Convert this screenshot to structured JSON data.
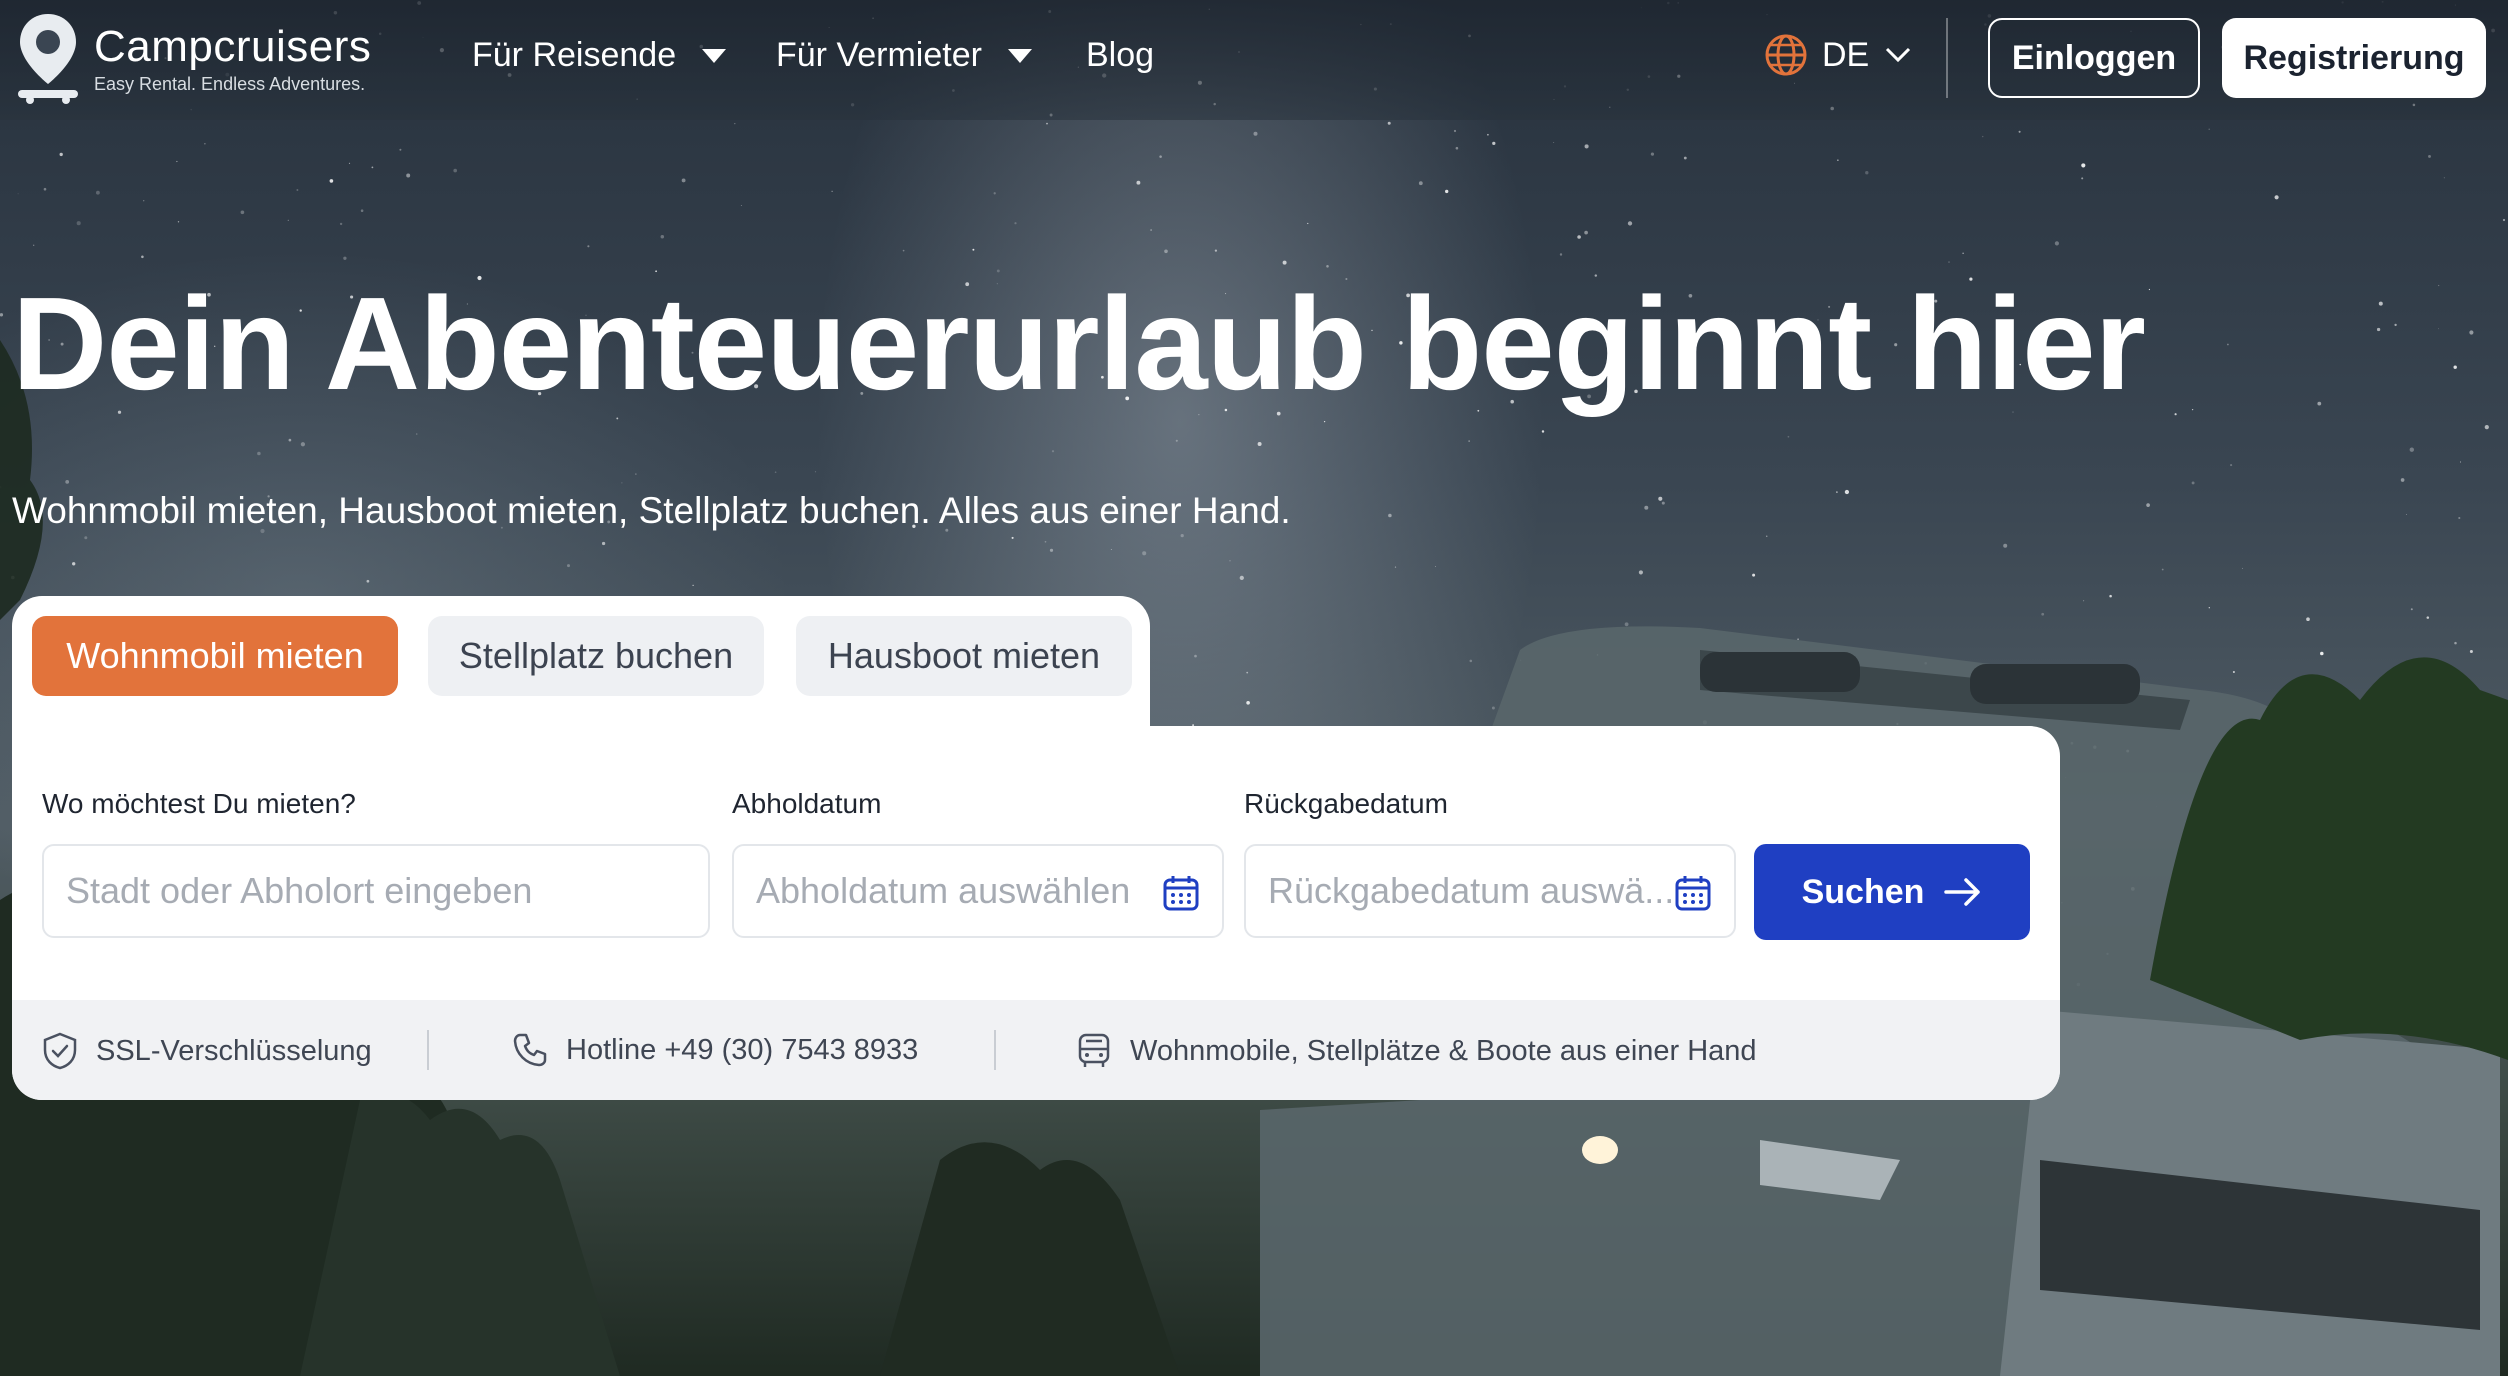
{
  "brand": {
    "name": "Campcruisers",
    "tagline": "Easy Rental. Endless Adventures."
  },
  "nav": {
    "links": [
      {
        "label": "Für Reisende",
        "has_dropdown": true
      },
      {
        "label": "Für Vermieter",
        "has_dropdown": true
      },
      {
        "label": "Blog",
        "has_dropdown": false
      }
    ],
    "language": "DE",
    "login_label": "Einloggen",
    "register_label": "Registrierung"
  },
  "hero": {
    "title": "Dein Abenteuerurlaub beginnt hier",
    "subtitle": "Wohnmobil mieten, Hausboot mieten, Stellplatz buchen. Alles aus einer Hand."
  },
  "search": {
    "tabs": [
      {
        "label": "Wohnmobil mieten",
        "active": true
      },
      {
        "label": "Stellplatz buchen",
        "active": false
      },
      {
        "label": "Hausboot mieten",
        "active": false
      }
    ],
    "location": {
      "label": "Wo möchtest Du mieten?",
      "placeholder": "Stadt oder Abholort eingeben"
    },
    "pickup": {
      "label": "Abholdatum",
      "placeholder": "Abholdatum auswählen"
    },
    "return": {
      "label": "Rückgabedatum",
      "placeholder": "Rückgabedatum auswä..."
    },
    "submit_label": "Suchen"
  },
  "trust": [
    {
      "icon": "shield-check-icon",
      "label": "SSL-Verschlüsselung"
    },
    {
      "icon": "phone-icon",
      "label": "Hotline +49 (30) 7543 8933"
    },
    {
      "icon": "bus-icon",
      "label": "Wohnmobile, Stellplätze & Boote aus einer Hand"
    }
  ],
  "colors": {
    "accent_orange": "#e2733b",
    "primary_blue": "#1f3fc2",
    "card_bg": "#ffffff",
    "trust_bar_bg": "#f1f2f4"
  }
}
